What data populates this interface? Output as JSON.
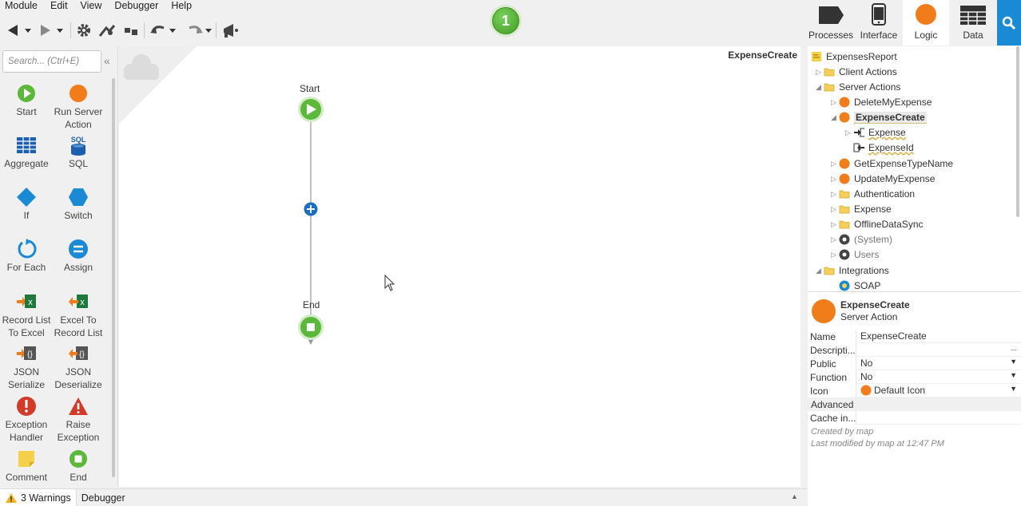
{
  "menu": [
    "Module",
    "Edit",
    "View",
    "Debugger",
    "Help"
  ],
  "badge": "1",
  "tabs": {
    "processes": "Processes",
    "interface": "Interface",
    "logic": "Logic",
    "data": "Data"
  },
  "toolbox": {
    "search_placeholder": "Search... (Ctrl+E)",
    "tools": [
      {
        "l1": "Start",
        "l2": ""
      },
      {
        "l1": "Run Server",
        "l2": "Action"
      },
      {
        "l1": "Aggregate",
        "l2": ""
      },
      {
        "l1": "SQL",
        "l2": ""
      },
      {
        "l1": "If",
        "l2": ""
      },
      {
        "l1": "Switch",
        "l2": ""
      },
      {
        "l1": "For Each",
        "l2": ""
      },
      {
        "l1": "Assign",
        "l2": ""
      },
      {
        "l1": "Record List",
        "l2": "To Excel"
      },
      {
        "l1": "Excel To",
        "l2": "Record List"
      },
      {
        "l1": "JSON",
        "l2": "Serialize"
      },
      {
        "l1": "JSON",
        "l2": "Deserialize"
      },
      {
        "l1": "Exception",
        "l2": "Handler"
      },
      {
        "l1": "Raise",
        "l2": "Exception"
      },
      {
        "l1": "Comment",
        "l2": ""
      },
      {
        "l1": "End",
        "l2": ""
      }
    ],
    "sql_icon_text": "SQL"
  },
  "canvas": {
    "title": "ExpenseCreate",
    "start_label": "Start",
    "end_label": "End"
  },
  "tree": [
    {
      "label": "ExpensesReport",
      "arrow": "",
      "icon": "module-icon"
    },
    {
      "label": "Client Actions",
      "arrow": "▷",
      "icon": "folder-icon"
    },
    {
      "label": "Server Actions",
      "arrow": "◢",
      "icon": "folder-open-icon"
    },
    {
      "label": "DeleteMyExpense",
      "arrow": "▷",
      "icon": "server-action-icon"
    },
    {
      "label": "ExpenseCreate",
      "arrow": "◢",
      "icon": "server-action-icon"
    },
    {
      "label": "Expense",
      "arrow": "▷",
      "icon": "input-parameter-icon"
    },
    {
      "label": "ExpenseId",
      "arrow": "",
      "icon": "output-parameter-icon"
    },
    {
      "label": "GetExpenseTypeName",
      "arrow": "▷",
      "icon": "server-action-icon"
    },
    {
      "label": "UpdateMyExpense",
      "arrow": "▷",
      "icon": "server-action-icon"
    },
    {
      "label": "Authentication",
      "arrow": "▷",
      "icon": "folder-icon"
    },
    {
      "label": "Expense",
      "arrow": "▷",
      "icon": "folder-icon"
    },
    {
      "label": "OfflineDataSync",
      "arrow": "▷",
      "icon": "folder-icon"
    },
    {
      "label": "(System)",
      "arrow": "▷",
      "icon": "reference-icon"
    },
    {
      "label": "Users",
      "arrow": "▷",
      "icon": "reference-icon"
    },
    {
      "label": "Integrations",
      "arrow": "◢",
      "icon": "folder-open-icon"
    },
    {
      "label": "SOAP",
      "arrow": "",
      "icon": "soap-icon"
    }
  ],
  "props": {
    "title": "ExpenseCreate",
    "subtitle": "Server Action",
    "rows": [
      {
        "k": "Name",
        "v": "ExpenseCreate"
      },
      {
        "k": "Descripti...",
        "v": ""
      },
      {
        "k": "Public",
        "v": "No"
      },
      {
        "k": "Function",
        "v": "No"
      },
      {
        "k": "Icon",
        "v": "Default Icon"
      }
    ],
    "section": "Advanced",
    "cache_label": "Cache in...",
    "created": "Created by map",
    "modified": "Last modified by map at 12:47 PM",
    "ellipsis": "..."
  },
  "bottom": {
    "warnings": "3 Warnings",
    "debugger": "Debugger"
  },
  "colors": {
    "accent": "#1a8ad4",
    "green": "#5cb83a",
    "orange": "#f07d1a"
  }
}
